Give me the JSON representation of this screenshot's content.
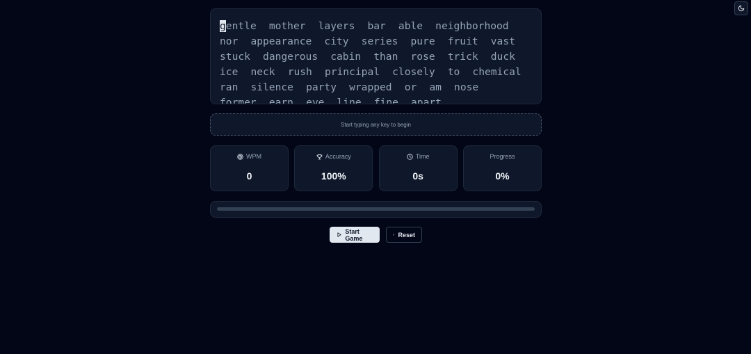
{
  "theme_toggle": {
    "icon": "moon-icon"
  },
  "typing_text": {
    "cursor_char": "g",
    "first_word_rest": "entle",
    "words": [
      "mother",
      "layers",
      "bar",
      "able",
      "neighborhood",
      "nor",
      "appearance",
      "city",
      "series",
      "pure",
      "fruit",
      "vast",
      "stuck",
      "dangerous",
      "cabin",
      "than",
      "rose",
      "trick",
      "duck",
      "ice",
      "neck",
      "rush",
      "principal",
      "closely",
      "to",
      "chemical",
      "ran",
      "silence",
      "party",
      "wrapped",
      "or",
      "am",
      "nose",
      "former",
      "earn",
      "eye",
      "line",
      "fine",
      "apart"
    ]
  },
  "input_prompt": "Start typing any key to begin",
  "stats": {
    "wpm": {
      "label": "WPM",
      "value": "0",
      "icon": "target-icon"
    },
    "accuracy": {
      "label": "Accuracy",
      "value": "100%",
      "icon": "trophy-icon"
    },
    "time": {
      "label": "Time",
      "value": "0s",
      "icon": "clock-icon"
    },
    "progress": {
      "label": "Progress",
      "value": "0%"
    }
  },
  "progress_fraction": 0,
  "buttons": {
    "start_label": "Start Game",
    "reset_label": "Reset"
  }
}
